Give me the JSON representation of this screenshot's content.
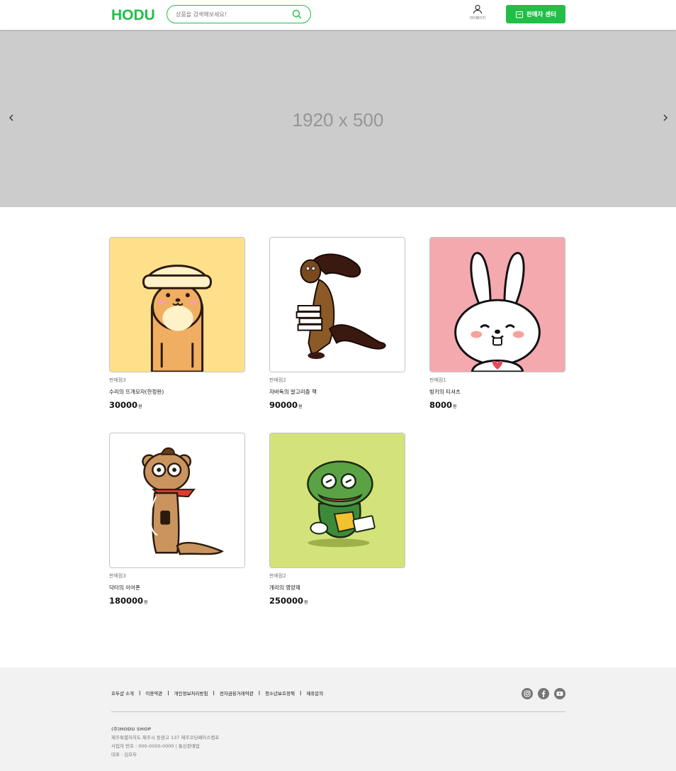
{
  "header": {
    "logo_text": "HODU",
    "search_placeholder": "상품을 검색해보세요!",
    "mypage_label": "마이페이지",
    "seller_center_label": "판매자 센터"
  },
  "banner": {
    "text": "1920 x 500"
  },
  "products": [
    {
      "store": "판매점3",
      "name": "수리의 뜨개모자(한정판)",
      "price": "30000",
      "unit": "원"
    },
    {
      "store": "판매점2",
      "name": "자바독의 알고리즘 책",
      "price": "90000",
      "unit": "원"
    },
    {
      "store": "판매점1",
      "name": "빙키의 티셔츠",
      "price": "8000",
      "unit": "원"
    },
    {
      "store": "판매점3",
      "name": "닥터의 이어폰",
      "price": "180000",
      "unit": "원"
    },
    {
      "store": "판매점2",
      "name": "개리의 영양제",
      "price": "250000",
      "unit": "원"
    }
  ],
  "footer": {
    "links": [
      "호두샵 소개",
      "이용약관",
      "개인정보처리방침",
      "전자금융거래약관",
      "청소년보호정책",
      "제휴문의"
    ],
    "separator": "|",
    "company": "(주)HODU SHOP",
    "address": "제주특별자치도 제주시 동광고 137 제주코딩베이스캠프",
    "business_number": "사업자 번호 : 000-0000-0000 | 통신판매업",
    "ceo": "대표 : 김호두",
    "sns": [
      "instagram-icon",
      "facebook-icon",
      "youtube-icon"
    ]
  },
  "colors": {
    "brand": "#21BF48",
    "banner_bg": "#CCCCCC",
    "footer_bg": "#F2F2F2",
    "thumb_bg": [
      "#FFE08A",
      "#FFFFFF",
      "#F4A9AE",
      "#FFFFFF",
      "#D3E37A"
    ]
  }
}
